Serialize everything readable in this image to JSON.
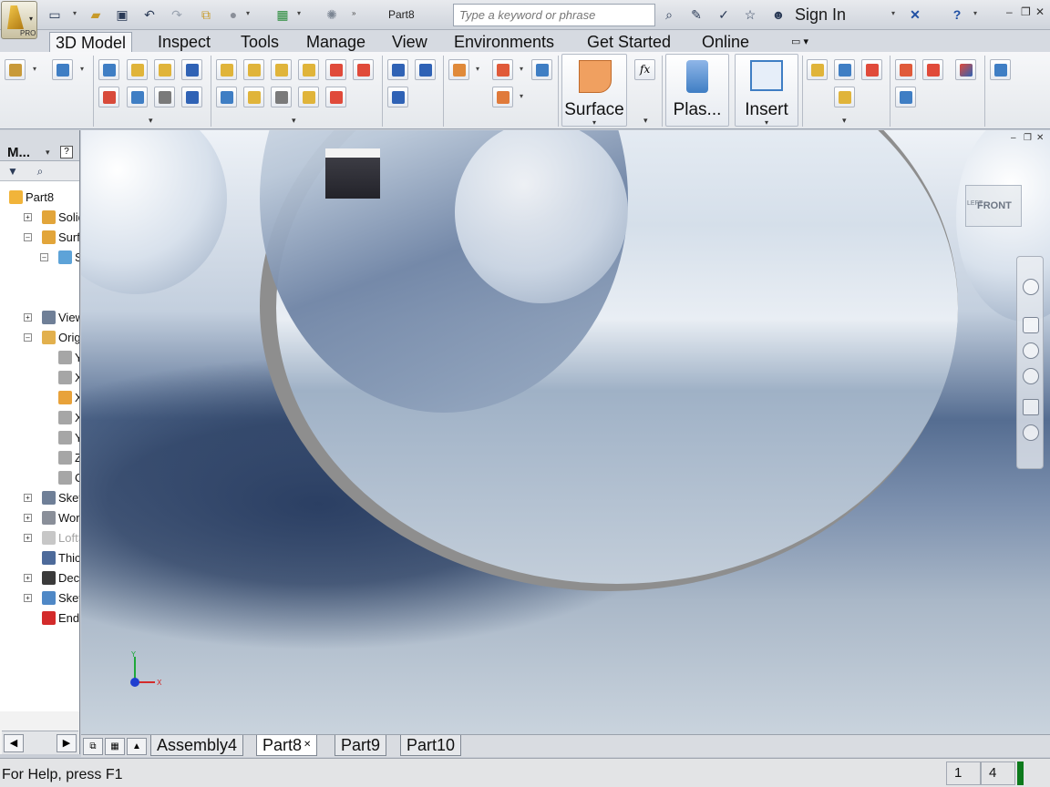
{
  "qat": {
    "document_name": "Part8",
    "search_placeholder": "Type a keyword or phrase",
    "sign_in_label": "Sign In",
    "app_badge": "PRO",
    "icons": [
      "new-icon",
      "open-icon",
      "save-icon",
      "undo-icon",
      "redo-icon",
      "return-icon",
      "select-icon",
      "material-icon",
      "appearance-icon",
      "binoculars-icon",
      "wrench-icon",
      "favorites-icon",
      "star-icon",
      "user-icon",
      "exchange-icon",
      "help-icon"
    ]
  },
  "tabs": [
    "3D Model",
    "Inspect",
    "Tools",
    "Manage",
    "View",
    "Environments",
    "Get Started",
    "Online"
  ],
  "active_tab": "3D Model",
  "ribbon": {
    "surface_label": "Surface",
    "plastic_label": "Plas...",
    "insert_label": "Insert",
    "fx_label": "fx"
  },
  "browser": {
    "title": "M...",
    "help": "?",
    "nodes": [
      {
        "label": "Part8",
        "icon": "part-icon",
        "color": "#f1b43a"
      },
      {
        "label": "Solid B",
        "icon": "solid-bodies-icon",
        "color": "#e2a53a"
      },
      {
        "label": "Surfac",
        "icon": "surface-bodies-icon",
        "color": "#e2a53a"
      },
      {
        "label": "Srf",
        "icon": "surface-icon",
        "color": "#5da3d8"
      },
      {
        "label": "View:",
        "icon": "view-rep-icon",
        "color": "#6f7f97"
      },
      {
        "label": "Origin",
        "icon": "origin-folder-icon",
        "color": "#e2b04d"
      },
      {
        "label": "YZ",
        "icon": "yz-plane-icon",
        "color": "#a6a6a6"
      },
      {
        "label": "XZ",
        "icon": "xz-plane-icon",
        "color": "#a6a6a6"
      },
      {
        "label": "XY",
        "icon": "xy-plane-icon",
        "color": "#e8a23a"
      },
      {
        "label": "X",
        "icon": "x-axis-icon",
        "color": "#a6a6a6"
      },
      {
        "label": "Y",
        "icon": "y-axis-icon",
        "color": "#a6a6a6"
      },
      {
        "label": "Z",
        "icon": "z-axis-icon",
        "color": "#a6a6a6"
      },
      {
        "label": "Ce",
        "icon": "center-point-icon",
        "color": "#a6a6a6"
      },
      {
        "label": "Sketc",
        "icon": "sketch-icon",
        "color": "#6f7f97"
      },
      {
        "label": "Work",
        "icon": "work-plane-icon",
        "color": "#8a8f99"
      },
      {
        "label": "LoftSi",
        "icon": "loft-icon",
        "color": "#c7c7c7"
      },
      {
        "label": "Thick",
        "icon": "thicken-icon",
        "color": "#4d6a9a"
      },
      {
        "label": "Decal",
        "icon": "decal-icon",
        "color": "#3a3a3a"
      },
      {
        "label": "Sketc",
        "icon": "sketch-icon",
        "color": "#4f88c6"
      },
      {
        "label": "End o",
        "icon": "end-of-part-icon",
        "color": "#d32b2b"
      }
    ]
  },
  "document_tabs": [
    "Assembly4",
    "Part8",
    "Part9",
    "Part10"
  ],
  "active_document_tab": "Part8",
  "viewcube_label": "FRONT",
  "viewcube_side_label": "LEFT",
  "triad": {
    "x": "X",
    "y": "Y"
  },
  "status": {
    "help_text": "For Help, press F1",
    "count_a": "1",
    "count_b": "4"
  }
}
